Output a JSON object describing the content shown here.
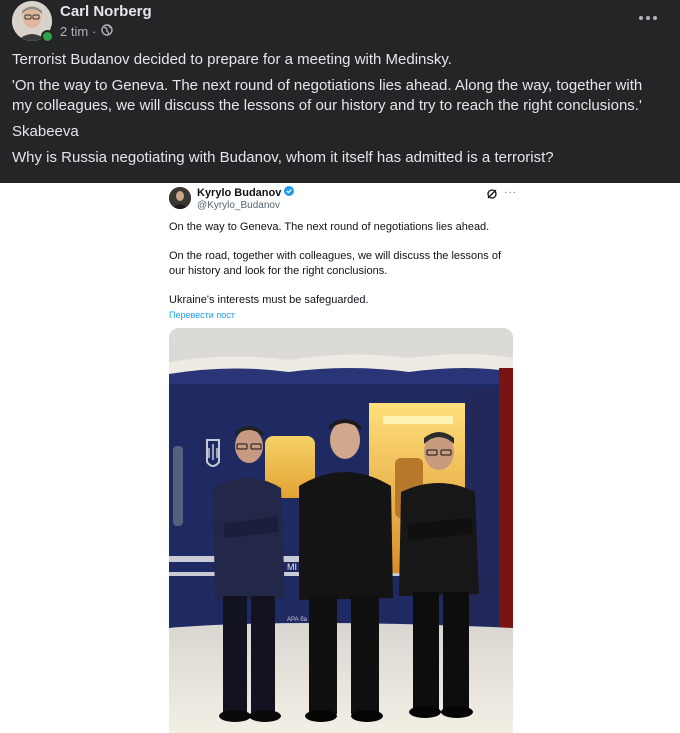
{
  "post": {
    "author": "Carl Norberg",
    "time": "2 tim",
    "paragraphs": [
      "Terrorist Budanov decided to prepare for a meeting with Medinsky.",
      "'On the way to Geneva. The next round of negotiations lies ahead. Along the way, together with my colleagues, we will discuss the lessons of our history and try to reach the right conclusions.'",
      "Skabeeva",
      "Why is Russia negotiating with Budanov, whom it itself has admitted is a terrorist?"
    ]
  },
  "tweet": {
    "name": "Kyrylo Budanov",
    "handle": "@Kyrylo_Budanov",
    "paragraphs": [
      "On the way to Geneva. The next round of negotiations lies ahead.",
      "On the road, together with colleagues, we will discuss the lessons of our history and look for the right conclusions.",
      "Ukraine's interests must be safeguarded."
    ],
    "translate_label": "Перевести пост",
    "photo_sign": "MI",
    "photo_sign_small": "АРА ба"
  },
  "icons": {
    "globe": "globe-icon",
    "more": "more-options-icon",
    "verified": "verified-badge-icon",
    "grok": "grok-icon"
  },
  "colors": {
    "background": "#242526",
    "text": "#e4e6eb",
    "secondary": "#b0b3b8",
    "online": "#31a24c",
    "link": "#1d9bf0",
    "verified": "#1d9bf0"
  }
}
